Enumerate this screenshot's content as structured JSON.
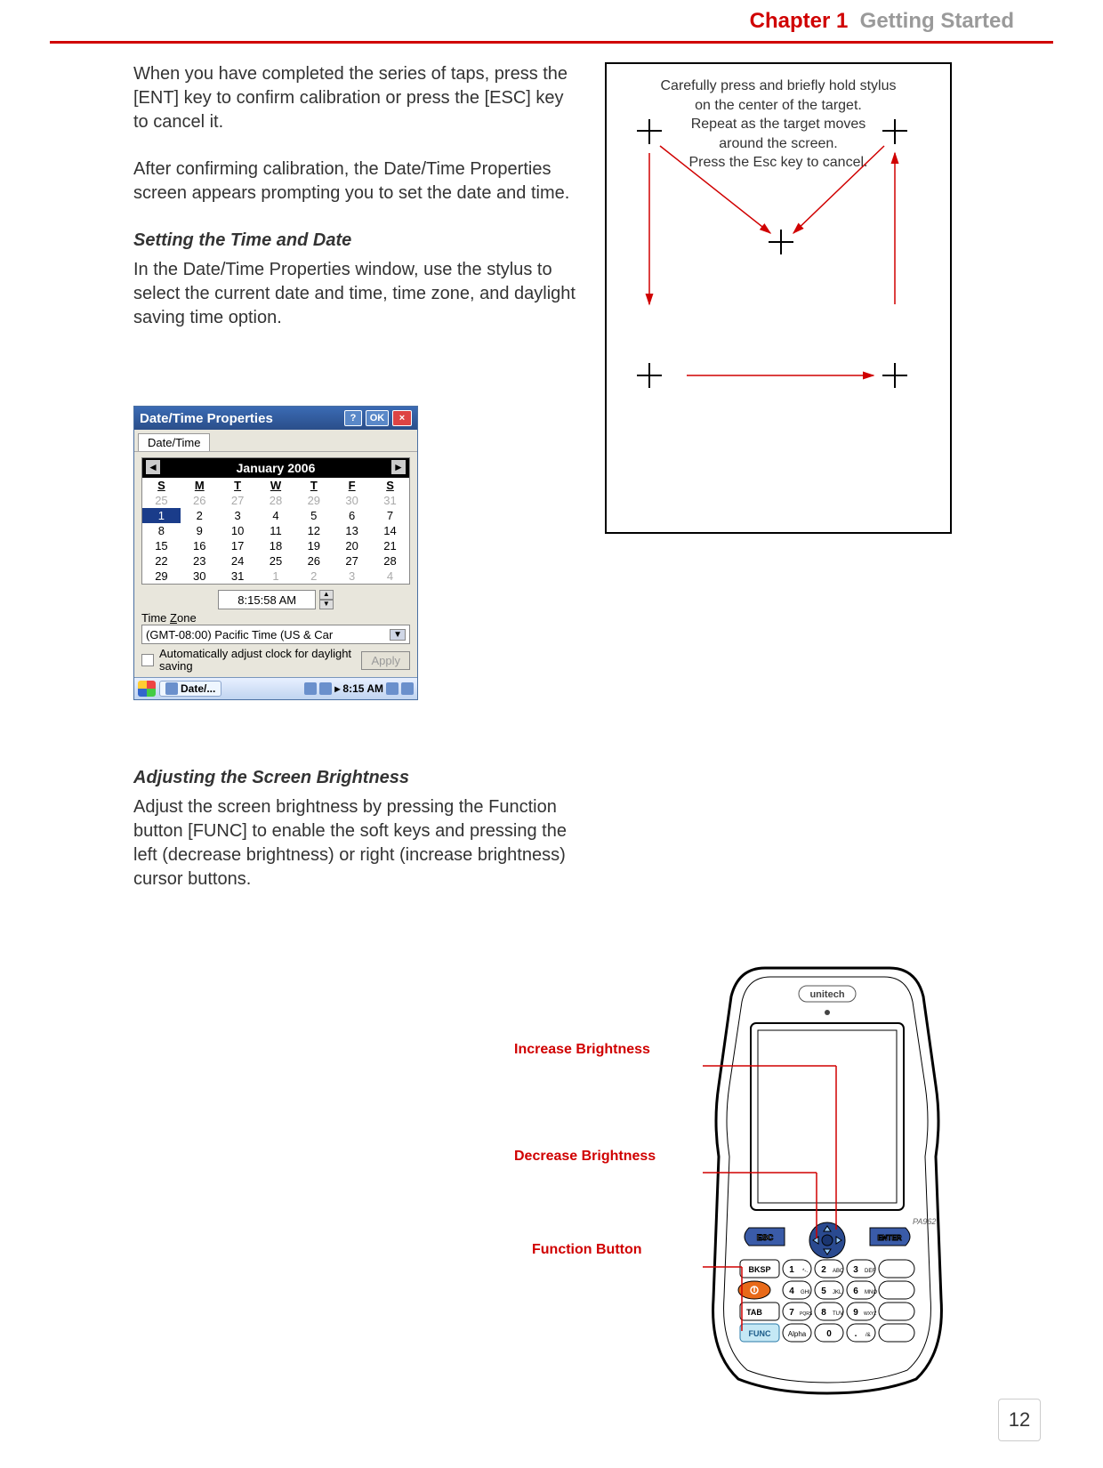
{
  "header": {
    "chapter": "Chapter 1",
    "title": "Getting Started"
  },
  "paragraphs": {
    "p1": "When you have completed the series of taps, press the [ENT] key to confirm calibration or press the [ESC] key to cancel it.",
    "p2": "After confirming calibration, the Date/Time Properties screen appears prompting you to set the date and time."
  },
  "section1": {
    "heading": "Setting the Time and Date",
    "text": "In the Date/Time Properties window, use the stylus to select the current date and time, time zone, and daylight saving time option."
  },
  "calibration": {
    "line1": "Carefully press and briefly hold stylus",
    "line2": "on the center of the target.",
    "line3": "Repeat as the target moves",
    "line4": "around the screen.",
    "line5": "Press the Esc key to cancel."
  },
  "datetime": {
    "title": "Date/Time Properties",
    "help": "?",
    "ok": "OK",
    "close": "×",
    "tab": "Date/Time",
    "month_year": "January 2006",
    "weekdays": [
      "S",
      "M",
      "T",
      "W",
      "T",
      "F",
      "S"
    ],
    "cal_rows": [
      [
        {
          "v": "25",
          "d": 1
        },
        {
          "v": "26",
          "d": 1
        },
        {
          "v": "27",
          "d": 1
        },
        {
          "v": "28",
          "d": 1
        },
        {
          "v": "29",
          "d": 1
        },
        {
          "v": "30",
          "d": 1
        },
        {
          "v": "31",
          "d": 1
        }
      ],
      [
        {
          "v": "1",
          "sel": 1
        },
        {
          "v": "2"
        },
        {
          "v": "3"
        },
        {
          "v": "4"
        },
        {
          "v": "5"
        },
        {
          "v": "6"
        },
        {
          "v": "7"
        }
      ],
      [
        {
          "v": "8"
        },
        {
          "v": "9"
        },
        {
          "v": "10"
        },
        {
          "v": "11"
        },
        {
          "v": "12"
        },
        {
          "v": "13"
        },
        {
          "v": "14"
        }
      ],
      [
        {
          "v": "15"
        },
        {
          "v": "16"
        },
        {
          "v": "17"
        },
        {
          "v": "18"
        },
        {
          "v": "19"
        },
        {
          "v": "20"
        },
        {
          "v": "21"
        }
      ],
      [
        {
          "v": "22"
        },
        {
          "v": "23"
        },
        {
          "v": "24"
        },
        {
          "v": "25"
        },
        {
          "v": "26"
        },
        {
          "v": "27"
        },
        {
          "v": "28"
        }
      ],
      [
        {
          "v": "29"
        },
        {
          "v": "30"
        },
        {
          "v": "31"
        },
        {
          "v": "1",
          "d": 1
        },
        {
          "v": "2",
          "d": 1
        },
        {
          "v": "3",
          "d": 1
        },
        {
          "v": "4",
          "d": 1
        }
      ]
    ],
    "time_value": "8:15:58 AM",
    "tz_label_pre": "Time ",
    "tz_label_u": "Z",
    "tz_label_post": "one",
    "tz_value": "(GMT-08:00) Pacific Time (US & Car",
    "dst_text": "Automatically adjust clock for daylight saving",
    "apply": "Apply",
    "taskbar": {
      "task_label": "Date/...",
      "clock": "8:15 AM",
      "arrow": "▸"
    }
  },
  "section2": {
    "heading": "Adjusting the Screen Brightness",
    "text": "Adjust the screen brightness by pressing the Function button [FUNC] to enable the soft keys and pressing the left (decrease brightness) or right (increase brightness) cursor buttons."
  },
  "device": {
    "brand": "unitech",
    "model": "PA962",
    "keys": {
      "esc": "ESC",
      "enter": "ENTER",
      "bksp": "BKSP",
      "tab": "TAB",
      "func": "FUNC",
      "alpha": "Alpha",
      "k1": "1",
      "k1s": "*-.",
      "k2": "2",
      "k2s": "ABC",
      "k3": "3",
      "k3s": "DEF",
      "k4": "4",
      "k4s": "GHI",
      "k5": "5",
      "k5s": "JKL",
      "k6": "6",
      "k6s": "MNO",
      "k7": "7",
      "k7s": "PQRS",
      "k8": "8",
      "k8s": "TUV",
      "k9": "9",
      "k9s": "WXYZ",
      "k0": "0",
      "kdot": ".",
      "kdot_s": "/&"
    },
    "labels": {
      "increase": "Increase Brightness",
      "decrease": "Decrease Brightness",
      "func": "Function Button"
    }
  },
  "page": {
    "number": "12"
  }
}
